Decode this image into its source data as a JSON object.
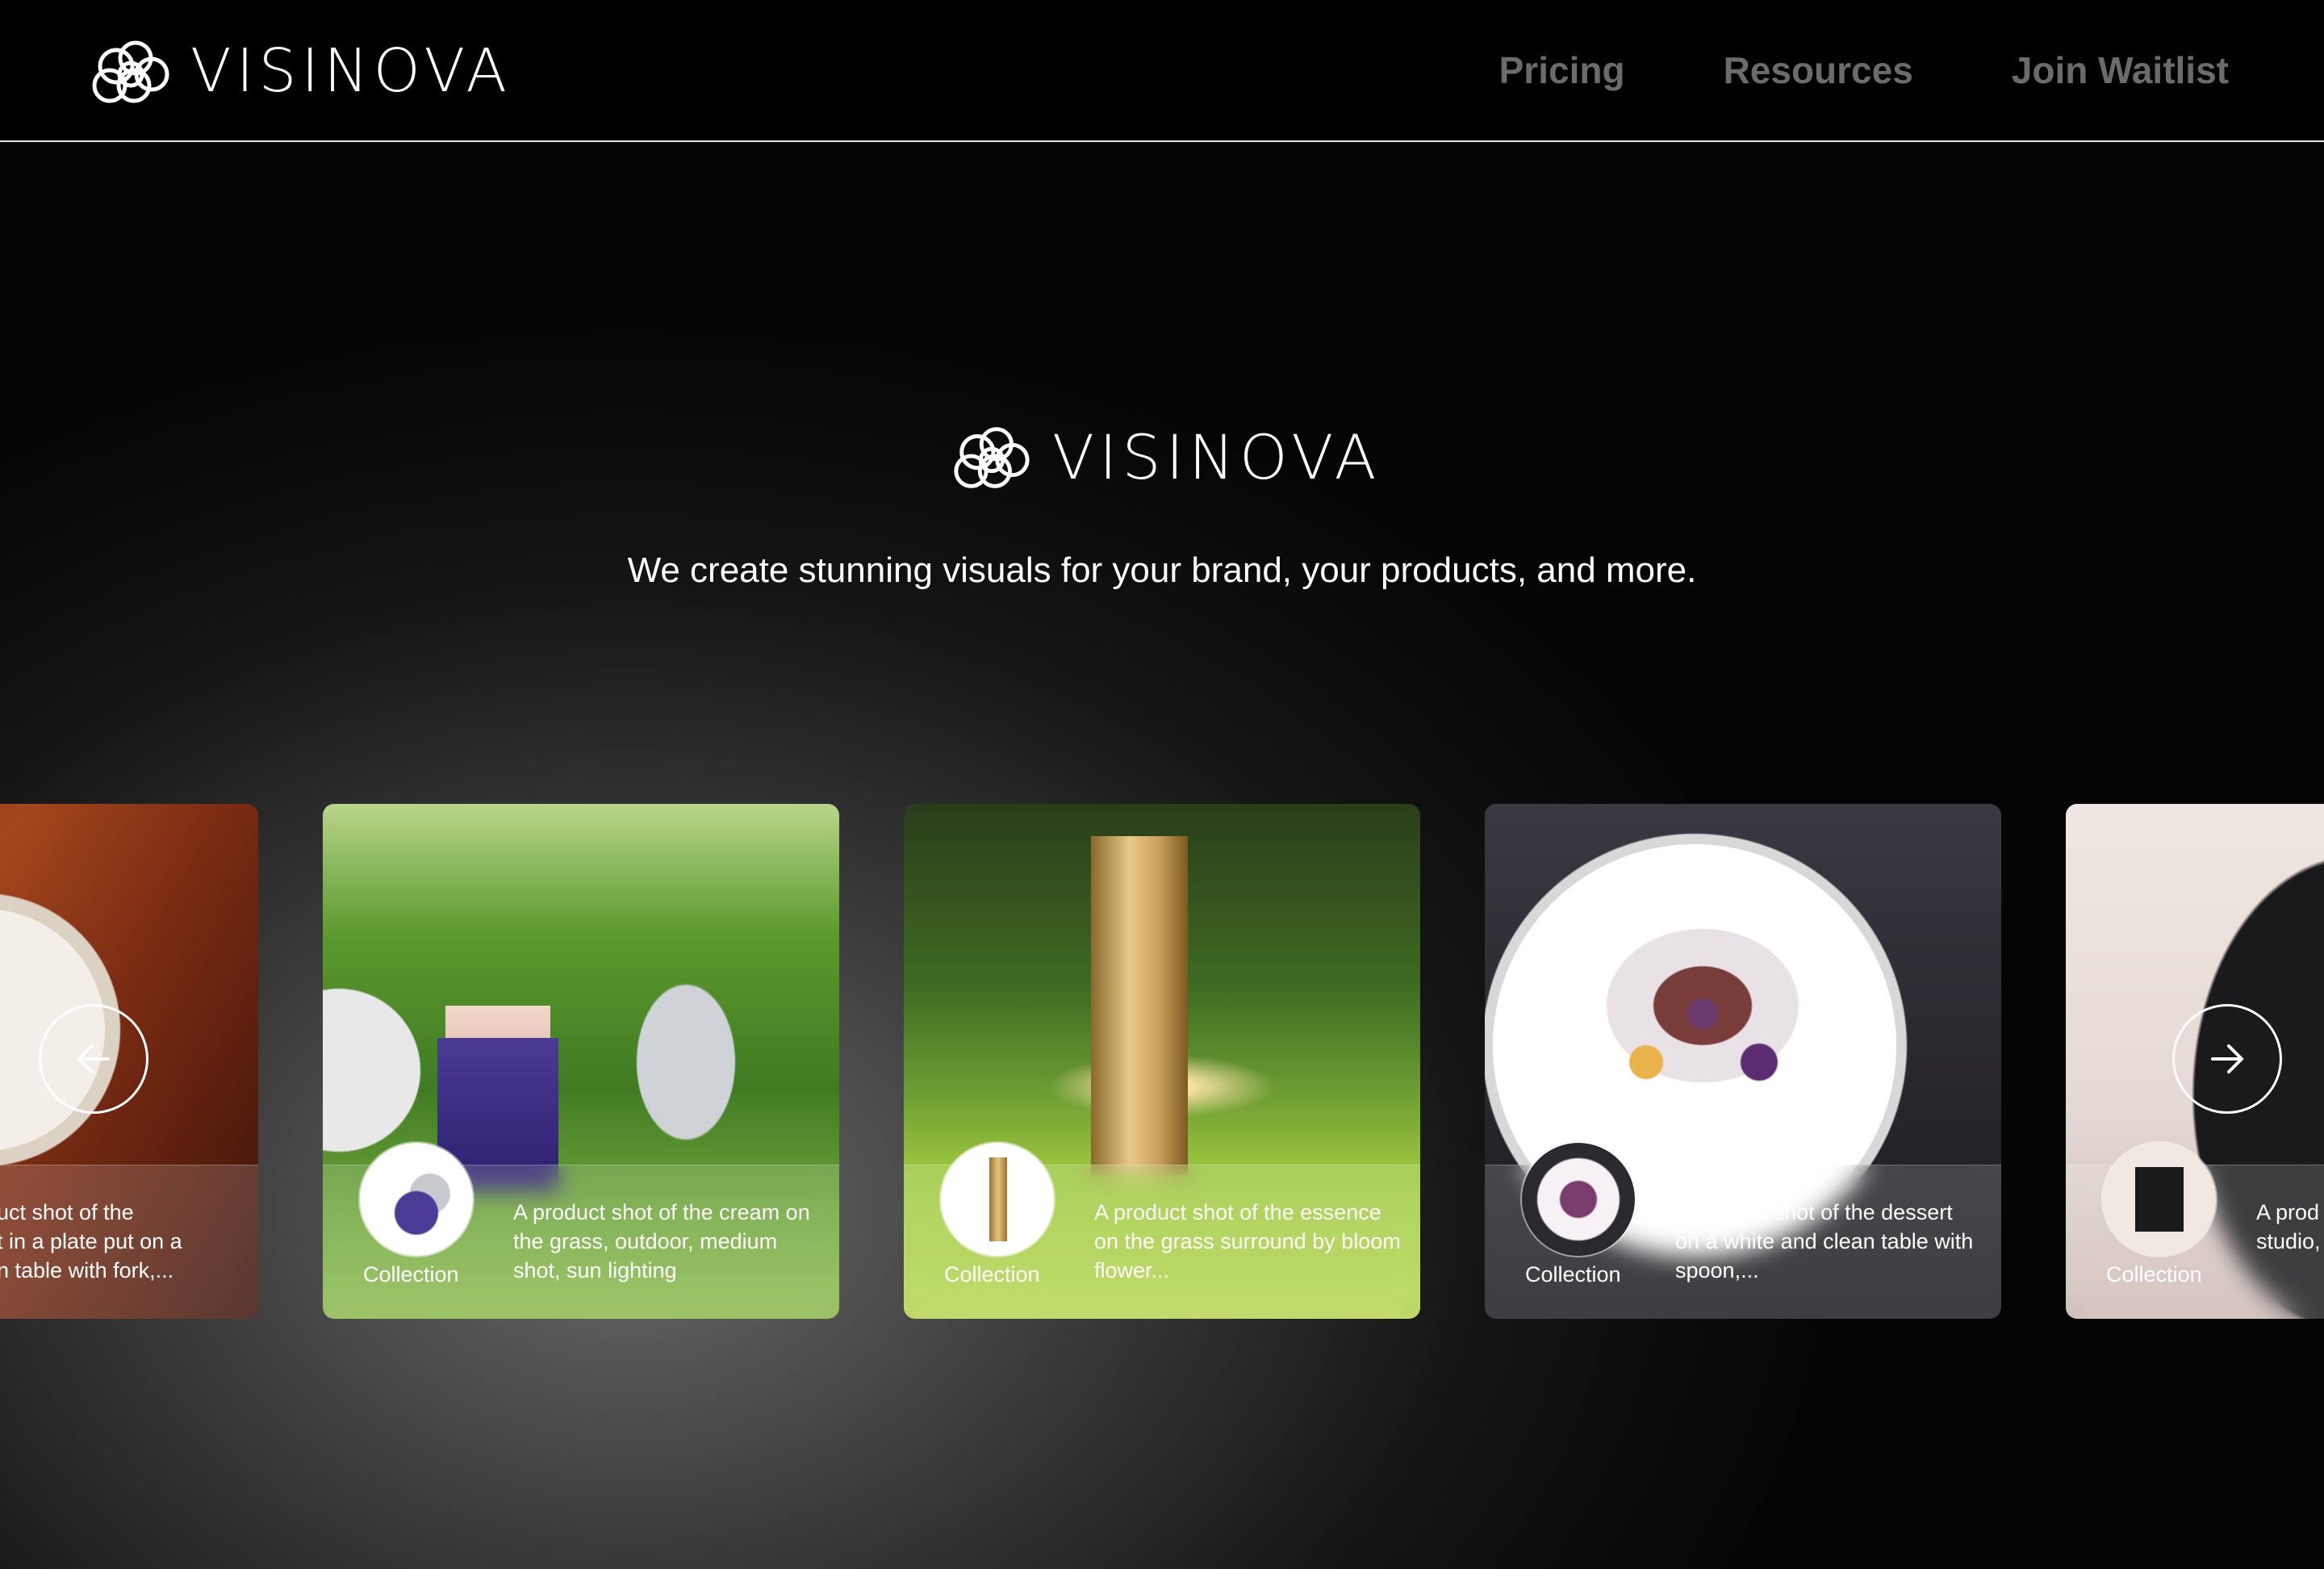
{
  "nav": {
    "brand": "VISINOVA",
    "links": [
      "Pricing",
      "Resources",
      "Join Waitlist"
    ]
  },
  "hero": {
    "brand": "VISINOVA",
    "tagline": "We create stunning visuals for your brand, your products, and more."
  },
  "carousel": {
    "cards": [
      {
        "label": "",
        "desc": "uct shot of the\nt in a plate put on a\nn table with fork,..."
      },
      {
        "label": "Collection",
        "desc": "A product shot of the cream on the grass, outdoor, medium shot, sun lighting"
      },
      {
        "label": "Collection",
        "desc": "A product shot of the essence on the grass surround by bloom flower..."
      },
      {
        "label": "Collection",
        "desc": "A product shot of the dessert on a white and clean table with spoon,..."
      },
      {
        "label": "Collection",
        "desc": "A prod\nstudio,"
      }
    ],
    "prev_icon": "arrow-left-icon",
    "next_icon": "arrow-right-icon"
  },
  "colors": {
    "nav_bg": "#000000",
    "nav_link": "#6b6b6b",
    "text": "#ffffff"
  }
}
